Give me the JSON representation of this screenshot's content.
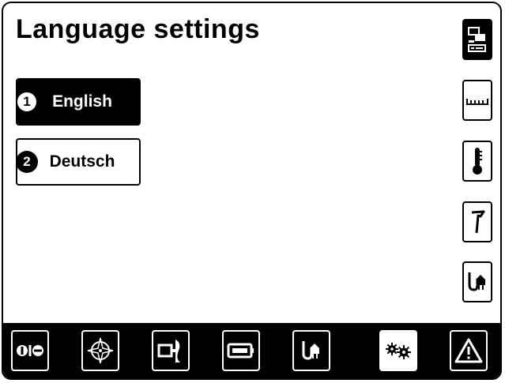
{
  "page": {
    "title": "Language settings"
  },
  "languages": [
    {
      "number": "1",
      "label": "English",
      "selected": true
    },
    {
      "number": "2",
      "label": "Deutsch",
      "selected": false
    }
  ],
  "sidebar": {
    "items": [
      {
        "icon": "display-settings-icon",
        "active": true
      },
      {
        "icon": "ruler-units-icon",
        "active": false
      },
      {
        "icon": "thermometer-icon",
        "active": false
      },
      {
        "icon": "flag-icon",
        "active": false
      },
      {
        "icon": "shore-power-icon",
        "active": false
      }
    ]
  },
  "bottom_bar": {
    "items": [
      {
        "icon": "switches-icon",
        "active": false
      },
      {
        "icon": "compass-icon",
        "active": false
      },
      {
        "icon": "tank-gauge-icon",
        "active": false
      },
      {
        "icon": "battery-icon",
        "active": false
      },
      {
        "icon": "shore-power-icon",
        "active": false
      },
      {
        "icon": "settings-gears-icon",
        "active": true
      },
      {
        "icon": "warning-icon",
        "active": false
      }
    ]
  }
}
